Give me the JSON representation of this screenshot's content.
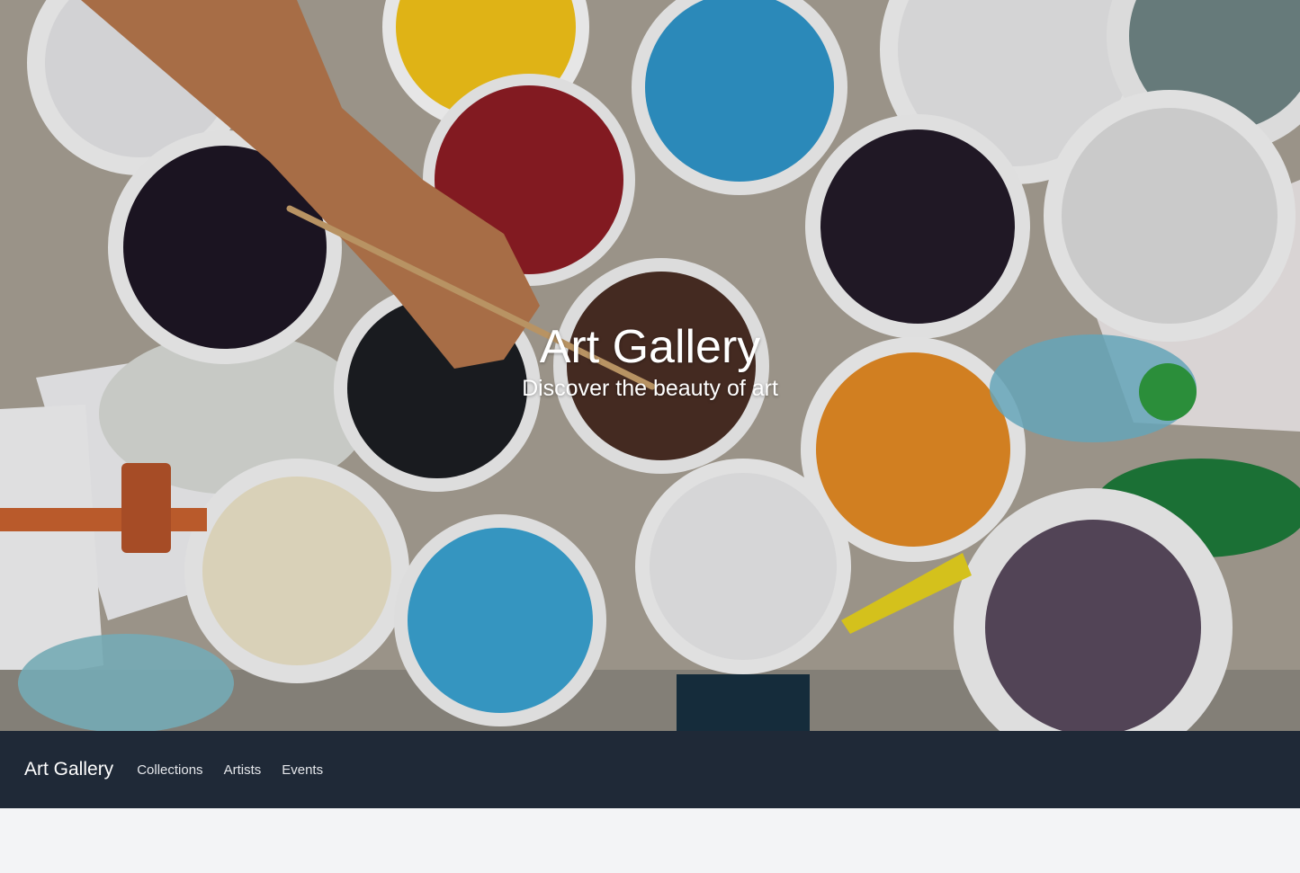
{
  "hero": {
    "title": "Art Gallery",
    "subtitle": "Discover the beauty of art",
    "image_description_icon": "paint-buckets-photo"
  },
  "navbar": {
    "brand": "Art Gallery",
    "links": [
      "Collections",
      "Artists",
      "Events"
    ]
  },
  "colors": {
    "navbar_bg": "#1f2937",
    "page_bg": "#f3f4f6",
    "text_light": "#ffffff"
  }
}
